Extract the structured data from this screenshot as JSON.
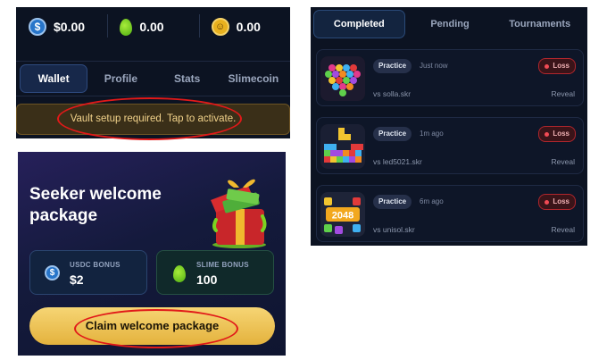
{
  "wallet": {
    "balances": [
      {
        "icon": "usdc-coin-icon",
        "value": "$0.00"
      },
      {
        "icon": "slime-drop-icon",
        "value": "0.00"
      },
      {
        "icon": "slimecoin-icon",
        "value": "0.00"
      }
    ],
    "tabs": [
      "Wallet",
      "Profile",
      "Stats",
      "Slimecoin"
    ],
    "active_tab": "Wallet",
    "notice": "Vault setup required. Tap to activate."
  },
  "welcome": {
    "title_line1": "Seeker welcome",
    "title_line2": "package",
    "gift_icon": "gift-box-icon",
    "usdc_bonus": {
      "label": "USDC BONUS",
      "value": "$2"
    },
    "slime_bonus": {
      "label": "SLIME BONUS",
      "value": "100"
    },
    "claim_label": "Claim welcome package"
  },
  "matches": {
    "tabs": [
      "Completed",
      "Pending",
      "Tournaments"
    ],
    "active_tab": "Completed",
    "items": [
      {
        "game_icon": "bubble-heart-game-icon",
        "mode": "Practice",
        "time": "Just now",
        "result": "Loss",
        "opponent": "vs solla.skr",
        "action": "Reveal"
      },
      {
        "game_icon": "block-puzzle-game-icon",
        "mode": "Practice",
        "time": "1m ago",
        "result": "Loss",
        "opponent": "vs led5021.skr",
        "action": "Reveal"
      },
      {
        "game_icon": "2048-game-icon",
        "game_label": "2048",
        "mode": "Practice",
        "time": "6m ago",
        "result": "Loss",
        "opponent": "vs unisol.skr",
        "action": "Reveal"
      }
    ]
  },
  "colors": {
    "accent": "#17284a",
    "loss": "#f24b55",
    "gold": "#e4b23d",
    "highlight_ring": "#e11919"
  }
}
